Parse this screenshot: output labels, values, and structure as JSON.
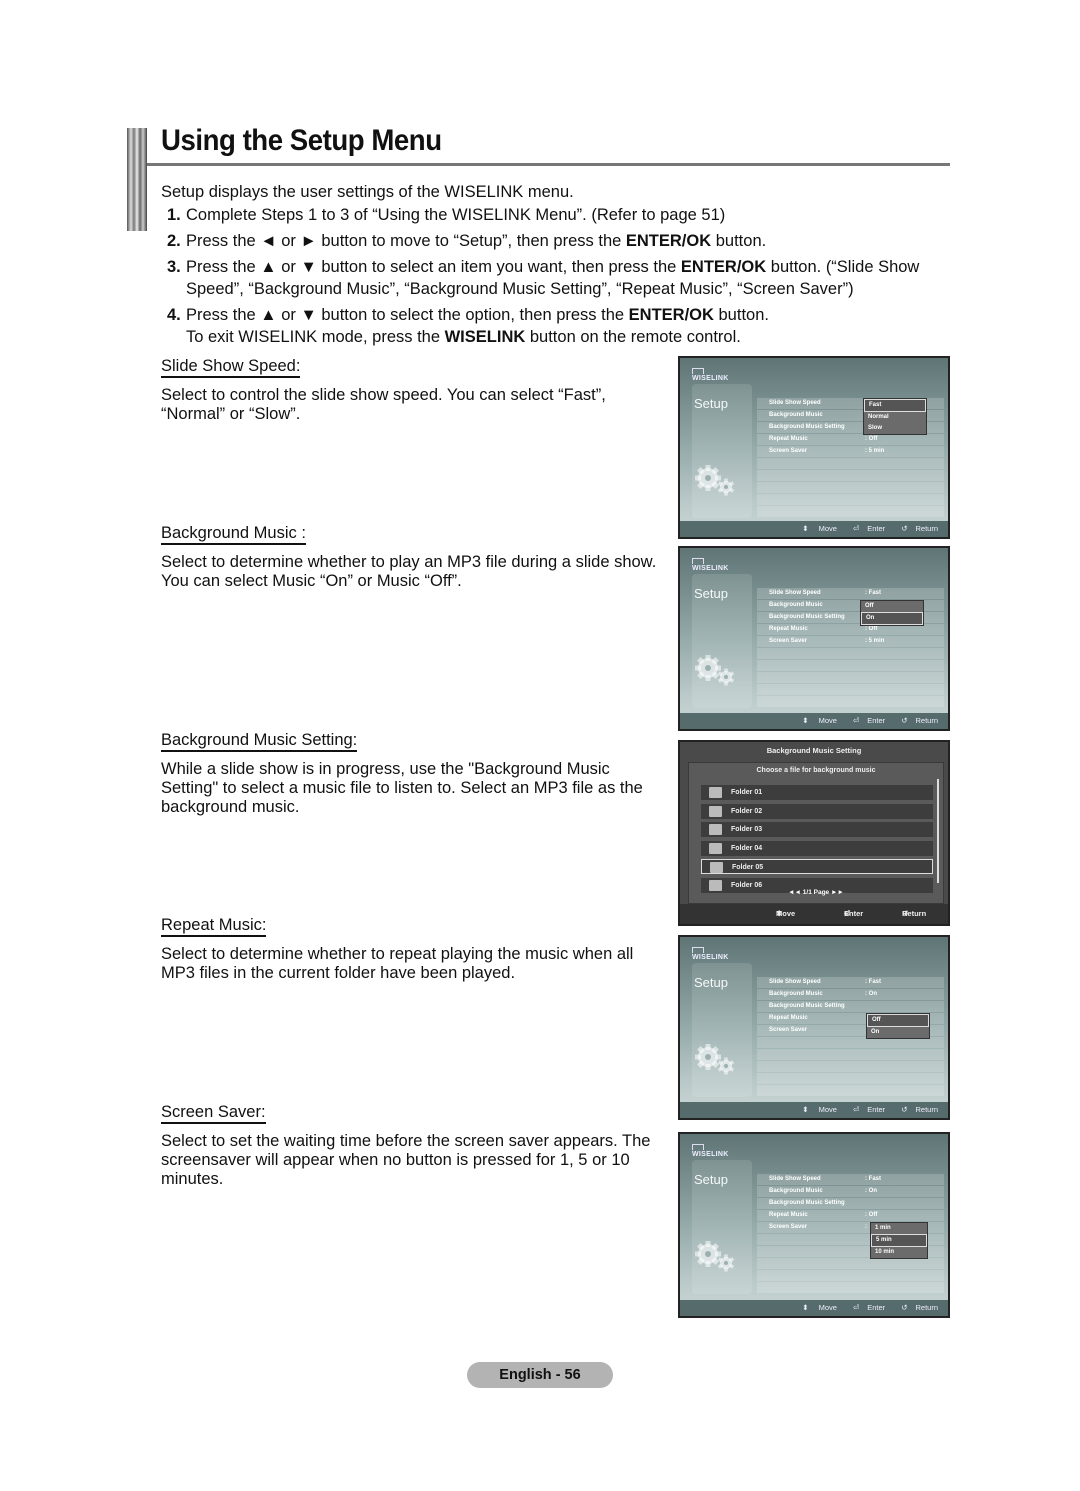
{
  "title": "Using the Setup Menu",
  "intro": "Setup displays the user settings of the WISELINK menu.",
  "steps": [
    {
      "num": "1.",
      "parts": [
        "Complete Steps 1 to 3 of “Using the WISELINK Menu”. (Refer to page 51)"
      ]
    },
    {
      "num": "2.",
      "pre": "Press the ◄ or ► button to move to “Setup”, then press the ",
      "bold": "ENTER/OK",
      "post": " button."
    },
    {
      "num": "3.",
      "pre": "Press the ▲ or ▼ button to select an item you want, then press the ",
      "bold": "ENTER/OK",
      "post": " button. (“Slide Show Speed”, “Background Music”, “Background Music Setting”, “Repeat Music”, “Screen Saver”)"
    },
    {
      "num": "4.",
      "pre": "Press the ▲ or ▼ button to select the option, then press the ",
      "bold": "ENTER/OK",
      "post": " button.",
      "line2_pre": "To exit WISELINK mode, press the ",
      "line2_bold": "WISELINK",
      "line2_post": " button on the remote control."
    }
  ],
  "sections": [
    {
      "heading": "Slide Show Speed:",
      "body": "Select to control the slide show speed. You can select “Fast”, “Normal” or “Slow”."
    },
    {
      "heading": "Background Music :",
      "body": "Select to determine whether to play an MP3 file during a slide show. You can select Music “On” or Music “Off”."
    },
    {
      "heading": "Background Music Setting:",
      "body": "While a slide show is in progress, use the \"Background Music Setting\" to select a music file to listen to. Select an MP3 file as the background music."
    },
    {
      "heading": "Repeat Music:",
      "body": "Select to determine whether to repeat playing the music when all MP3 files in the current folder have been played."
    },
    {
      "heading": "Screen Saver:",
      "body": "Select to set the waiting time before the screen saver appears. The screensaver will appear when no button is pressed for 1, 5 or 10 minutes."
    }
  ],
  "tv": {
    "logo": "WISELINK",
    "setup_label": "Setup",
    "footer": {
      "move": "Move",
      "enter": "Enter",
      "return": "Return"
    },
    "menu_labels": [
      "Slide Show Speed",
      "Background Music",
      "Background Music Setting",
      "Repeat Music",
      "Screen Saver"
    ],
    "screens": [
      {
        "values": [
          "",
          "",
          "",
          ": Off",
          ":  5 min"
        ],
        "dropdown_options": [
          "Fast",
          "Normal",
          "Slow"
        ],
        "selected": 0
      },
      {
        "values": [
          ":  Fast",
          "",
          "",
          ": Off",
          ":  5 min"
        ],
        "dropdown_options": [
          "Off",
          "On"
        ],
        "selected": 1
      },
      {
        "values": [
          ":  Fast",
          ":  On",
          "",
          "",
          ""
        ],
        "dropdown_options": [
          "Off",
          "On"
        ],
        "selected": 0
      },
      {
        "values": [
          ":  Fast",
          ":  On",
          "",
          ": Off",
          ":"
        ],
        "dropdown_options": [
          "1 min",
          "5 min",
          "10 min"
        ],
        "selected": 1
      }
    ]
  },
  "bg_music_setting": {
    "title": "Background Music Setting",
    "subtitle": "Choose a file for background music",
    "folders": [
      "Folder 01",
      "Folder 02",
      "Folder 03",
      "Folder 04",
      "Folder 05",
      "Folder 06"
    ],
    "selected": 4,
    "pager": "◄◄ 1/1 Page ►►",
    "footer": {
      "move": "Move",
      "enter": "Enter",
      "return": "Return"
    }
  },
  "page_label": "English - 56"
}
